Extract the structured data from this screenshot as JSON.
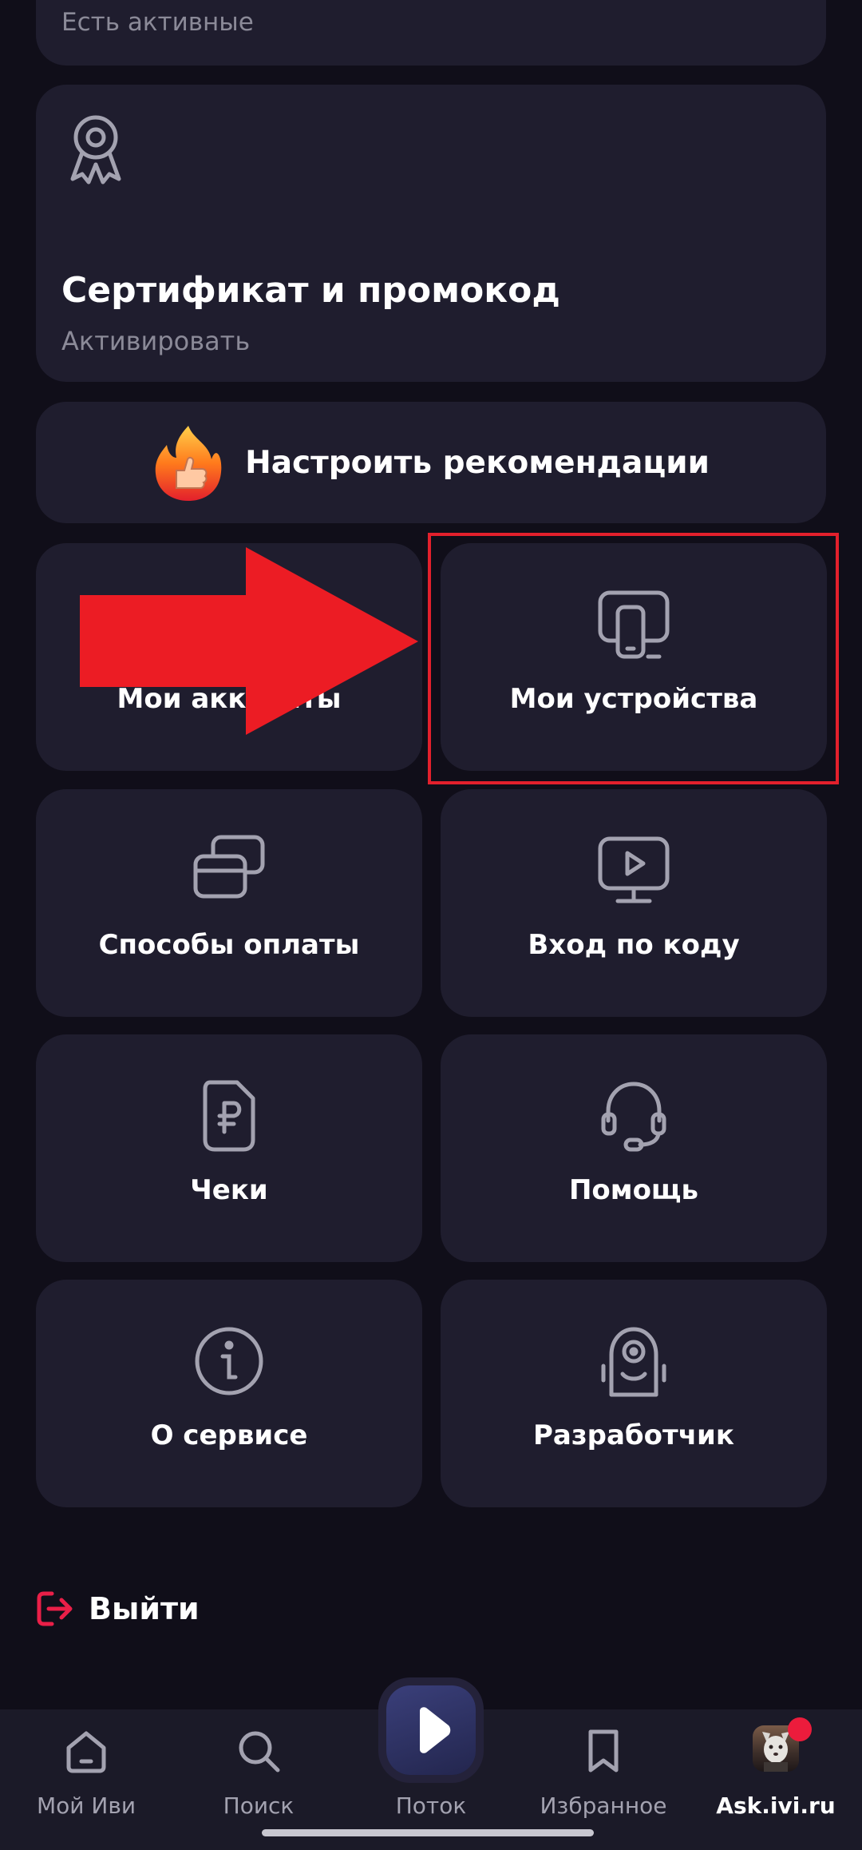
{
  "top_card": {
    "subtitle": "Есть активные"
  },
  "certificate": {
    "title": "Сертификат и промокод",
    "subtitle": "Активировать"
  },
  "recommendations": {
    "label": "Настроить рекомендации",
    "icon": "fire-thumbs-up-icon"
  },
  "tiles": {
    "accounts": {
      "label": "Мои аккаунты",
      "icon": "account-icon"
    },
    "devices": {
      "label": "Мои устройства",
      "icon": "devices-icon"
    },
    "payment": {
      "label": "Способы оплаты",
      "icon": "card-icon"
    },
    "code_login": {
      "label": "Вход по коду",
      "icon": "tv-play-icon"
    },
    "receipts": {
      "label": "Чеки",
      "icon": "receipt-ruble-icon"
    },
    "help": {
      "label": "Помощь",
      "icon": "headset-icon"
    },
    "about": {
      "label": "О сервисе",
      "icon": "info-icon"
    },
    "developer": {
      "label": "Разработчик",
      "icon": "robot-icon"
    }
  },
  "logout": {
    "label": "Выйти",
    "icon": "logout-icon"
  },
  "bottom_nav": {
    "items": [
      {
        "label": "Мой Иви",
        "icon": "home-icon"
      },
      {
        "label": "Поиск",
        "icon": "search-icon"
      },
      {
        "label": "Поток",
        "icon": "play-icon"
      },
      {
        "label": "Избранное",
        "icon": "bookmark-icon"
      },
      {
        "label": "Ask.ivi.ru",
        "icon": "avatar-icon"
      }
    ]
  },
  "colors": {
    "background": "#100e19",
    "card": "#1f1d2e",
    "muted_text": "#8b8a98",
    "accent_red": "#e3202c",
    "logout_red": "#ea1f48"
  }
}
